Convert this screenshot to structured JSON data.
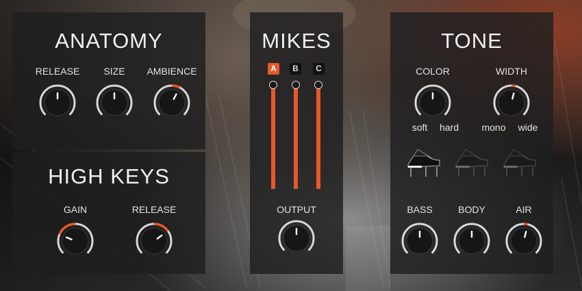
{
  "colors": {
    "accent": "#e8572a",
    "knob_ring": "#d8d8d8",
    "knob_body": "#161616",
    "panel_bg": "#1e1e20"
  },
  "anatomy": {
    "title": "ANATOMY",
    "knobs": [
      {
        "label": "RELEASE",
        "value": 0.5
      },
      {
        "label": "SIZE",
        "value": 0.5
      },
      {
        "label": "AMBIENCE",
        "value": 0.6
      }
    ]
  },
  "high_keys": {
    "title": "HIGH KEYS",
    "knobs": [
      {
        "label": "GAIN",
        "value": 0.25
      },
      {
        "label": "RELEASE",
        "value": 0.7
      }
    ]
  },
  "mikes": {
    "title": "MIKES",
    "channels": [
      {
        "label": "A",
        "active": true,
        "level": 1.0
      },
      {
        "label": "B",
        "active": false,
        "level": 1.0
      },
      {
        "label": "C",
        "active": false,
        "level": 1.0
      }
    ],
    "output": {
      "label": "OUTPUT",
      "value": 0.5
    }
  },
  "tone": {
    "title": "TONE",
    "color": {
      "label": "COLOR",
      "min_label": "soft",
      "max_label": "hard",
      "value": 0.5
    },
    "width": {
      "label": "WIDTH",
      "min_label": "mono",
      "max_label": "wide",
      "value": 0.55
    },
    "piano_presets": [
      {
        "icon": "grand-piano-icon",
        "active": true
      },
      {
        "icon": "grand-piano-icon",
        "active": false
      },
      {
        "icon": "grand-piano-icon",
        "active": false
      }
    ],
    "eq": [
      {
        "label": "BASS",
        "value": 0.5
      },
      {
        "label": "BODY",
        "value": 0.5
      },
      {
        "label": "AIR",
        "value": 0.55
      }
    ]
  }
}
